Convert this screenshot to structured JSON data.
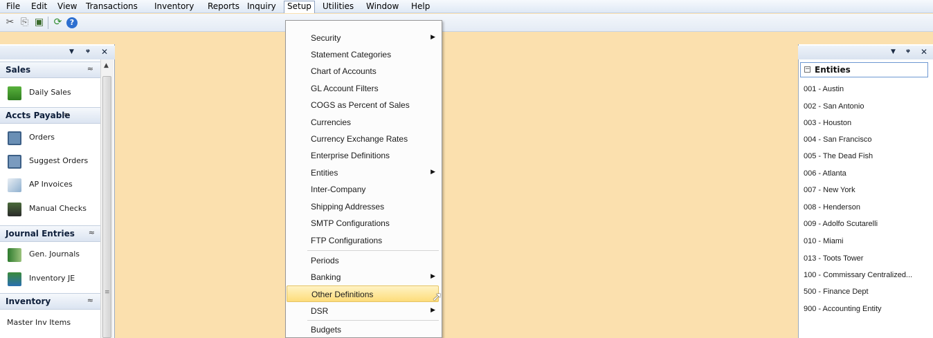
{
  "menubar": {
    "items": [
      "File",
      "Edit",
      "View",
      "Transactions",
      "Inventory",
      "Reports",
      "Inquiry",
      "Setup",
      "Utilities",
      "Window",
      "Help"
    ],
    "active": "Setup"
  },
  "toolbar": {
    "icons": [
      "scissors-icon",
      "copy-icon",
      "paste-icon",
      "refresh-icon",
      "help-icon"
    ]
  },
  "left_pane": {
    "controls": [
      "▾",
      "⊣",
      "✕"
    ],
    "groups": [
      {
        "label": "Sales",
        "items": [
          "Daily Sales"
        ]
      },
      {
        "label": "Accts Payable",
        "items": [
          "Orders",
          "Suggest Orders",
          "AP Invoices",
          "Manual Checks"
        ]
      },
      {
        "label": "Journal Entries",
        "items": [
          "Gen. Journals",
          "Inventory JE"
        ]
      },
      {
        "label": "Inventory",
        "items": [
          "Master Inv Items"
        ]
      }
    ]
  },
  "setup_menu": {
    "items": [
      {
        "label": "Security",
        "submenu": true
      },
      {
        "label": "Statement Categories",
        "submenu": false
      },
      {
        "label": "Chart of Accounts",
        "submenu": false
      },
      {
        "label": "GL Account Filters",
        "submenu": false
      },
      {
        "label": "COGS as Percent of Sales",
        "submenu": false
      },
      {
        "label": "Currencies",
        "submenu": false
      },
      {
        "label": "Currency Exchange Rates",
        "submenu": false
      },
      {
        "label": "Enterprise Definitions",
        "submenu": false
      },
      {
        "label": "Entities",
        "submenu": true
      },
      {
        "label": "Inter-Company",
        "submenu": false
      },
      {
        "label": "Shipping Addresses",
        "submenu": false
      },
      {
        "label": "SMTP Configurations",
        "submenu": false
      },
      {
        "label": "FTP Configurations",
        "submenu": false
      },
      {
        "label": "Periods",
        "submenu": false
      },
      {
        "label": "Banking",
        "submenu": true
      },
      {
        "label": "Other Definitions",
        "submenu": false,
        "highlighted": true
      },
      {
        "label": "DSR",
        "submenu": true
      },
      {
        "label": "Budgets",
        "submenu": false
      }
    ]
  },
  "right_pane": {
    "title": "Entities",
    "entities": [
      "001 - Austin",
      "002 - San Antonio",
      "003 - Houston",
      "004 - San Francisco",
      "005 - The Dead Fish",
      "006 - Atlanta",
      "007 - New York",
      "008 - Henderson",
      "009 - Adolfo Scutarelli",
      "010 - Miami",
      "013 - Toots Tower",
      "100 - Commissary Centralized...",
      "500 - Finance Dept",
      "900 - Accounting Entity"
    ]
  },
  "colors": {
    "workspace": "#fbe0ae",
    "highlight": "#fddc7a"
  }
}
